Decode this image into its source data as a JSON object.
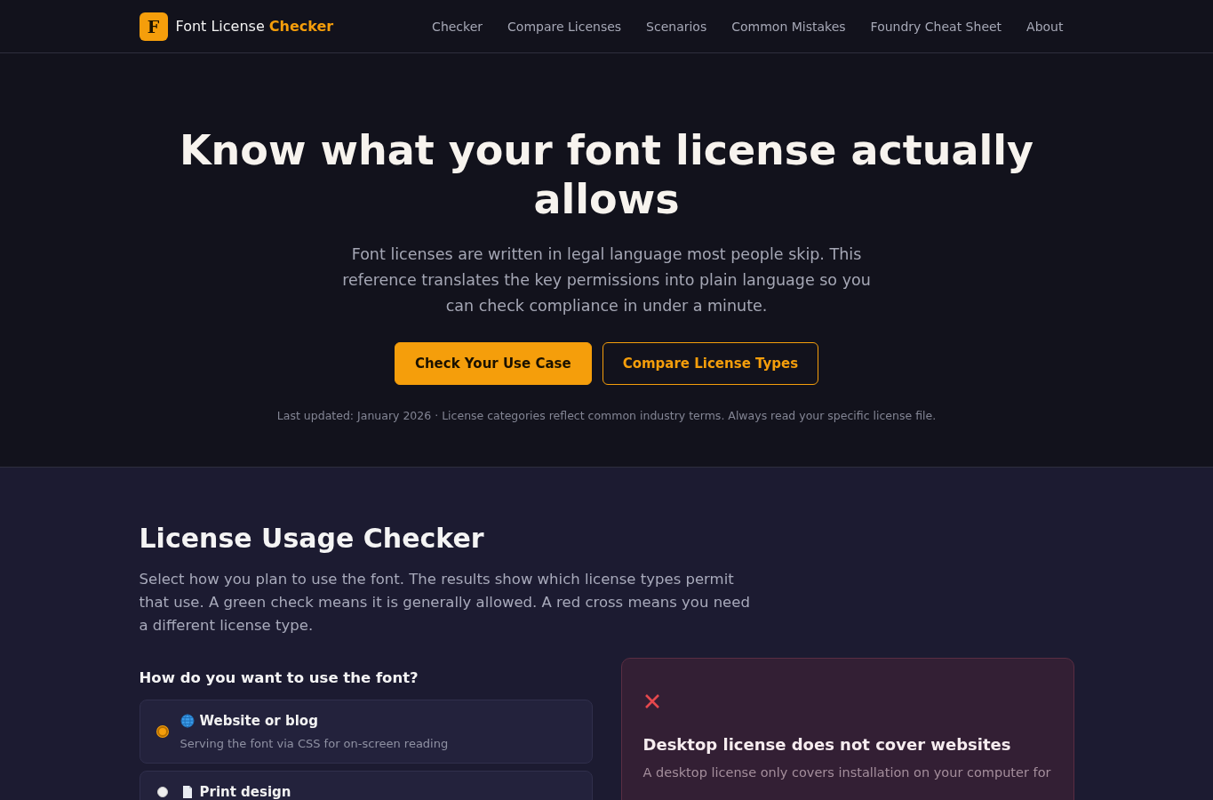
{
  "brand": {
    "logo_letter": "F",
    "name": "Font License",
    "name_accent": "Checker"
  },
  "nav": [
    "Checker",
    "Compare Licenses",
    "Scenarios",
    "Common Mistakes",
    "Foundry Cheat Sheet",
    "About"
  ],
  "hero": {
    "title": "Know what your font license actually allows",
    "lead": "Font licenses are written in legal language most people skip. This reference translates the key permissions into plain language so you can check compliance in under a minute.",
    "primary_button": "Check Your Use Case",
    "secondary_button": "Compare License Types",
    "note": "Last updated: January 2026 · License categories reflect common industry terms. Always read your specific license file."
  },
  "checker": {
    "title": "License Usage Checker",
    "intro": "Select how you plan to use the font. The results show which license types permit that use. A green check means it is generally allowed. A red cross means you need a different license type.",
    "question": "How do you want to use the font?",
    "options": [
      {
        "kind": "globe",
        "label": "Website or blog",
        "description": "Serving the font via CSS for on-screen reading",
        "selected": true
      },
      {
        "kind": "document",
        "label": "Print design",
        "selected": false
      }
    ],
    "result": {
      "allowed": false,
      "title": "Desktop license does not cover websites",
      "body": "A desktop license only covers installation on your computer for"
    }
  }
}
